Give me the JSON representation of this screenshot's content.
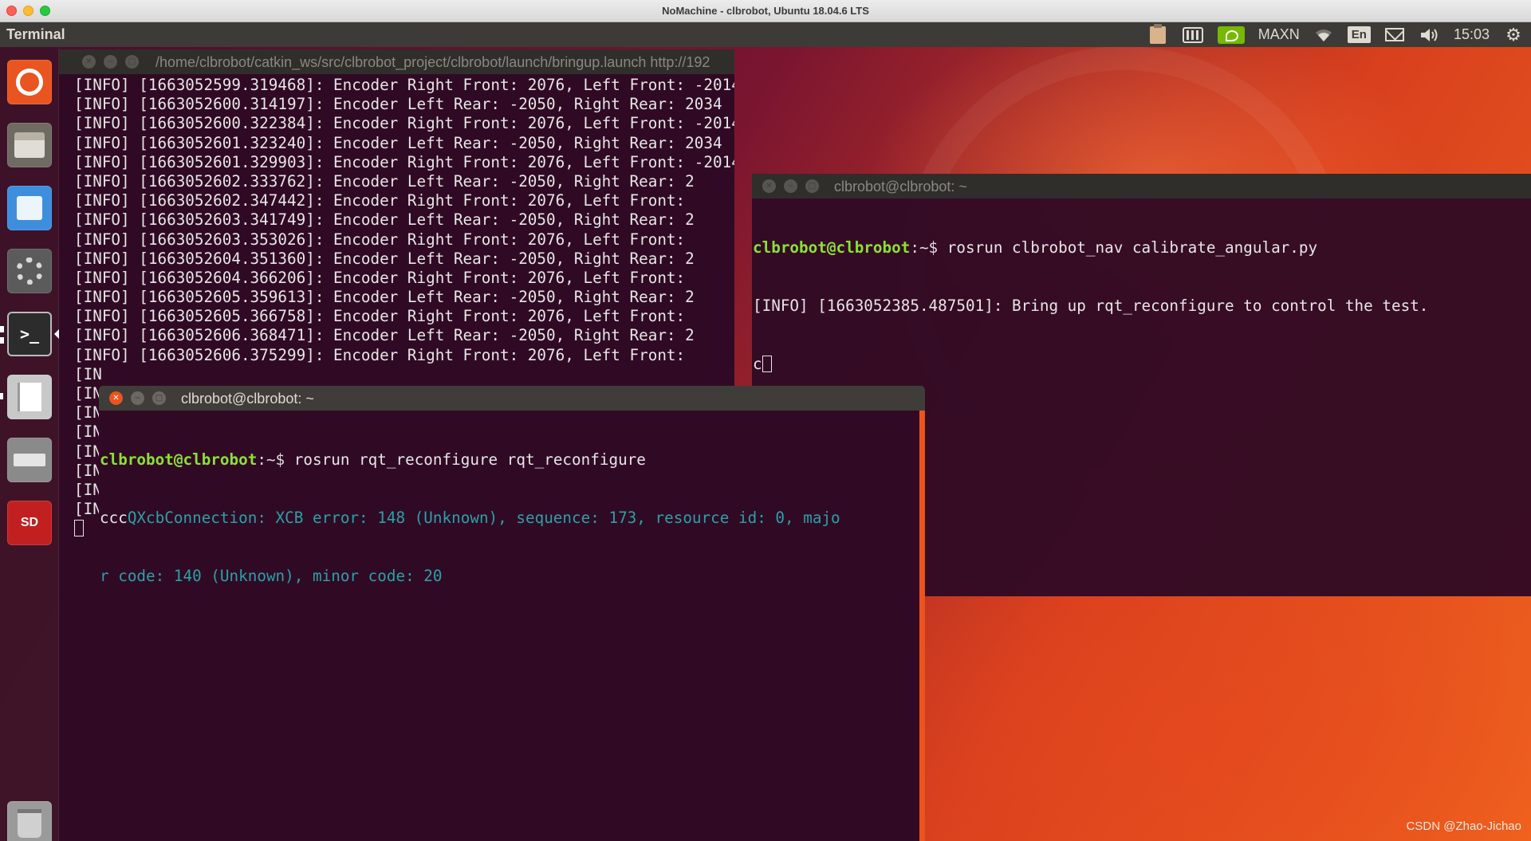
{
  "mac_window": {
    "title": "NoMachine - clbrobot, Ubuntu 18.04.6 LTS"
  },
  "panel": {
    "app_name": "Terminal",
    "gpu_mode": "MAXN",
    "keyboard_lang": "En",
    "clock": "15:03",
    "icons": [
      "clipboard-icon",
      "memory-icon",
      "nvidia-icon",
      "wifi-icon",
      "mail-icon",
      "volume-icon",
      "power-gear-icon"
    ]
  },
  "launcher": {
    "items": [
      "ubuntu-dash",
      "files",
      "software-store",
      "system-settings",
      "terminal",
      "text-editor",
      "drive",
      "sd-card",
      "trash"
    ],
    "sd_label": "SD",
    "terminal_glyph": ">_"
  },
  "window_back": {
    "title": "/home/clbrobot/catkin_ws/src/clbrobot_project/clbrobot/launch/bringup.launch http://192",
    "lines": [
      "[INFO] [1663052599.319468]: Encoder Right Front: 2076, Left Front: -2014",
      "[INFO] [1663052600.314197]: Encoder Left Rear: -2050, Right Rear: 2034",
      "[INFO] [1663052600.322384]: Encoder Right Front: 2076, Left Front: -2014",
      "[INFO] [1663052601.323240]: Encoder Left Rear: -2050, Right Rear: 2034",
      "[INFO] [1663052601.329903]: Encoder Right Front: 2076, Left Front: -2014",
      "[INFO] [1663052602.333762]: Encoder Left Rear: -2050, Right Rear: 2",
      "[INFO] [1663052602.347442]: Encoder Right Front: 2076, Left Front:",
      "[INFO] [1663052603.341749]: Encoder Left Rear: -2050, Right Rear: 2",
      "[INFO] [1663052603.353026]: Encoder Right Front: 2076, Left Front:",
      "[INFO] [1663052604.351360]: Encoder Left Rear: -2050, Right Rear: 2",
      "[INFO] [1663052604.366206]: Encoder Right Front: 2076, Left Front:",
      "[INFO] [1663052605.359613]: Encoder Left Rear: -2050, Right Rear: 2",
      "[INFO] [1663052605.366758]: Encoder Right Front: 2076, Left Front:",
      "[INFO] [1663052606.368471]: Encoder Left Rear: -2050, Right Rear: 2",
      "[INFO] [1663052606.375299]: Encoder Right Front: 2076, Left Front:",
      "[IN",
      "[IN",
      "[IN",
      "[IN",
      "[IN",
      "[IN",
      "[IN",
      "[IN"
    ]
  },
  "window_right": {
    "title": "clbrobot@clbrobot: ~",
    "prompt_user": "clbrobot@clbrobot",
    "prompt_path": ":~$ ",
    "command": "rosrun clbrobot_nav calibrate_angular.py",
    "output": "[INFO] [1663052385.487501]: Bring up rqt_reconfigure to control the test.",
    "typed": "c"
  },
  "window_front": {
    "title": "clbrobot@clbrobot: ~",
    "prompt_user": "clbrobot@clbrobot",
    "prompt_path": ":~$ ",
    "command": "rosrun rqt_reconfigure rqt_reconfigure",
    "typed": "ccc",
    "error_line1": "QXcbConnection: XCB error: 148 (Unknown), sequence: 173, resource id: 0, majo",
    "error_line2": "r code: 140 (Unknown), minor code: 20"
  },
  "watermark": "CSDN @Zhao-Jichao"
}
